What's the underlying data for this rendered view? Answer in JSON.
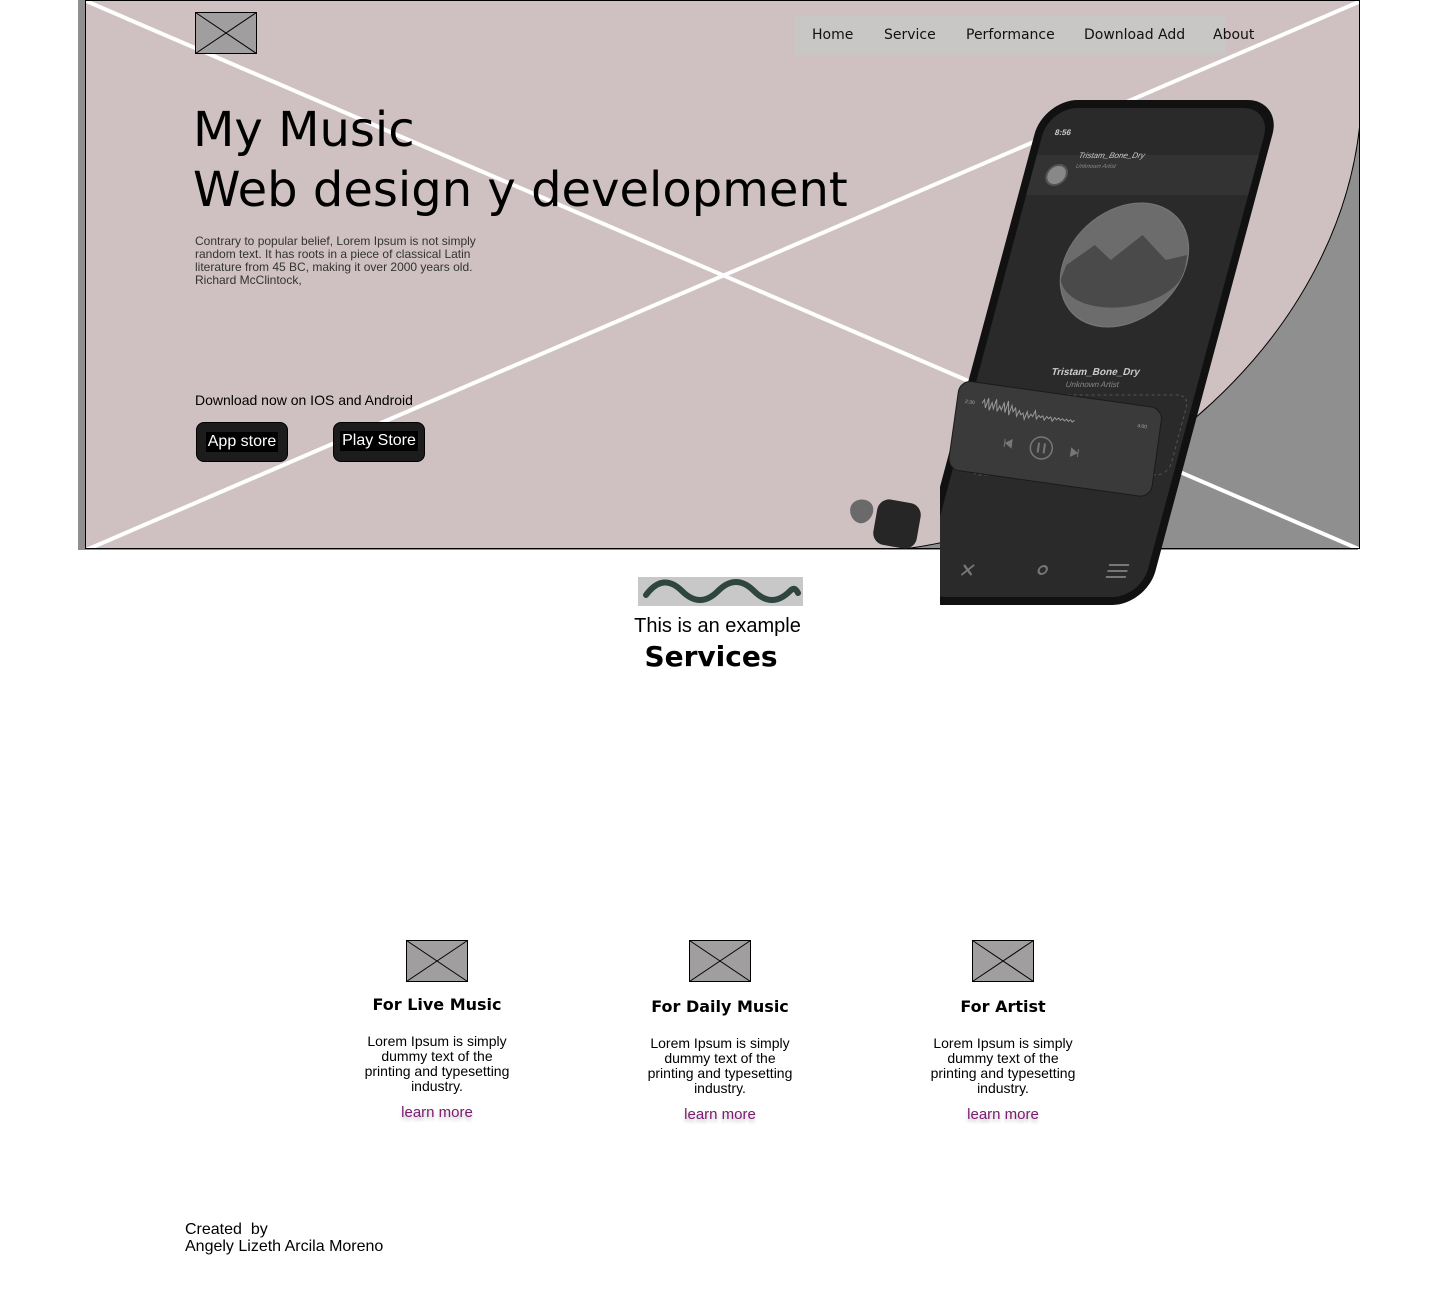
{
  "nav": {
    "items": [
      "Home",
      "Service",
      "Performance",
      "Download Add",
      "About"
    ]
  },
  "hero": {
    "title_line1": "My Music",
    "title_line2": "Web design y development",
    "description": "Contrary to popular belief, Lorem Ipsum is not simply random text. It has roots in a piece of classical Latin literature from 45 BC, making it over 2000 years old. Richard McClintock,",
    "download_text": "Download now on IOS and Android",
    "app_store_label": "App store",
    "play_store_label": "Play Store"
  },
  "phone": {
    "time": "8:56",
    "track_title": "Tristam_Bone_Dry",
    "track_artist": "Unknown Artist",
    "now_playing_title": "Tristam_Bone_Dry",
    "now_playing_artist": "Unknown Artist",
    "elapsed": "2:30",
    "duration": "4:00"
  },
  "services": {
    "kicker": "This is an example",
    "title": "Services",
    "cards": [
      {
        "title": "For Live Music",
        "text": "Lorem Ipsum is simply dummy text of the printing and typesetting industry.",
        "link": "learn more"
      },
      {
        "title": "For Daily Music",
        "text": "Lorem Ipsum is simply dummy text of the printing and typesetting industry.",
        "link": "learn more"
      },
      {
        "title": "For Artist",
        "text": "Lorem Ipsum is simply dummy text of the printing and typesetting industry.",
        "link": "learn more"
      }
    ]
  },
  "footer": {
    "created_by": "Created  by",
    "author": "Angely Lizeth Arcila Moreno"
  },
  "colors": {
    "hero_bg": "#cfc1c1",
    "nav_bg": "#c9c6c6",
    "link": "#7a1a6e",
    "placeholder": "#a09e9e"
  },
  "icons": {
    "logo": "image-placeholder-icon",
    "card_image": "image-placeholder-icon",
    "wave": "wave-divider-icon"
  }
}
